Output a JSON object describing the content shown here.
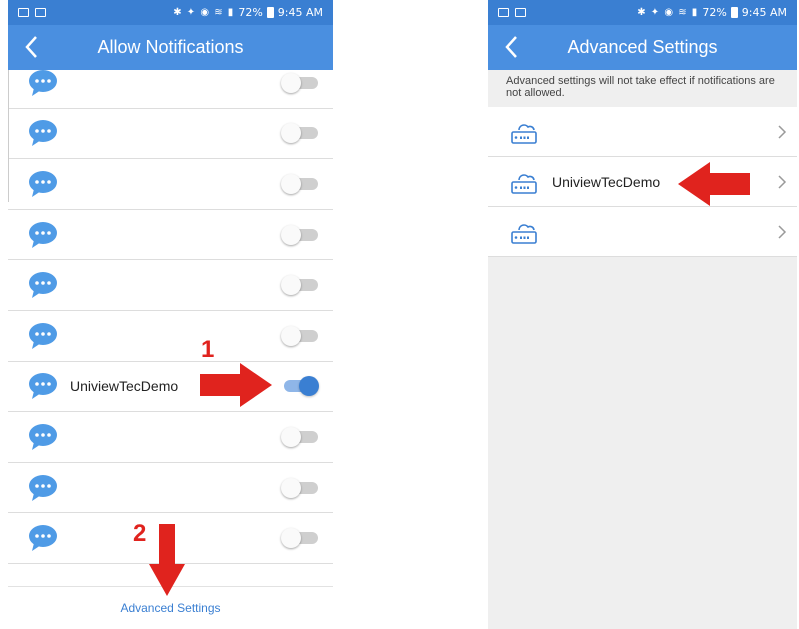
{
  "status_bar": {
    "time": "9:45 AM",
    "battery": "72%"
  },
  "colors": {
    "header": "#4a8fe0",
    "status": "#3a7fd2",
    "accent": "#3a7fd2",
    "annotation": "#e0231e"
  },
  "left_screen": {
    "title": "Allow Notifications",
    "items": [
      {
        "label": "",
        "enabled": false
      },
      {
        "label": "",
        "enabled": false
      },
      {
        "label": "",
        "enabled": false
      },
      {
        "label": "",
        "enabled": false
      },
      {
        "label": "",
        "enabled": false
      },
      {
        "label": "",
        "enabled": false
      },
      {
        "label": "UniviewTecDemo",
        "enabled": true
      },
      {
        "label": "",
        "enabled": false
      },
      {
        "label": "",
        "enabled": false
      },
      {
        "label": "",
        "enabled": false
      }
    ],
    "footer_link": "Advanced Settings"
  },
  "right_screen": {
    "title": "Advanced Settings",
    "notice": "Advanced settings will not take effect if notifications are not allowed.",
    "devices": [
      {
        "label": ""
      },
      {
        "label": "UniviewTecDemo"
      },
      {
        "label": ""
      }
    ]
  },
  "annotations": {
    "step1": "1",
    "step2": "2"
  }
}
